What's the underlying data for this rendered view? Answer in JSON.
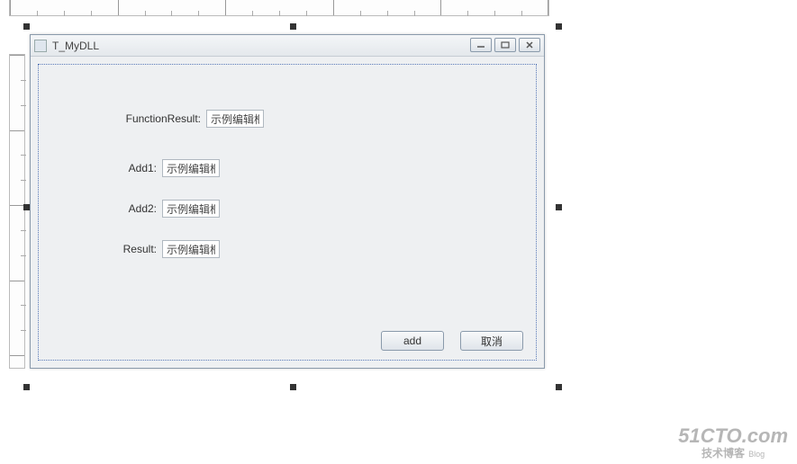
{
  "window": {
    "title": "T_MyDLL"
  },
  "form": {
    "rows": [
      {
        "label": "FunctionResult:",
        "value": "示例编辑框",
        "label_class": ""
      },
      {
        "label": "Add1:",
        "value": "示例编辑框",
        "label_class": "sm"
      },
      {
        "label": "Add2:",
        "value": "示例编辑框",
        "label_class": "sm"
      },
      {
        "label": "Result:",
        "value": "示例编辑框",
        "label_class": "sm"
      }
    ]
  },
  "buttons": {
    "ok_label": "add",
    "cancel_label": "取消"
  },
  "watermark": {
    "line1": "51CTO.com",
    "line2": "技术博客",
    "line2_suffix": "Blog"
  }
}
